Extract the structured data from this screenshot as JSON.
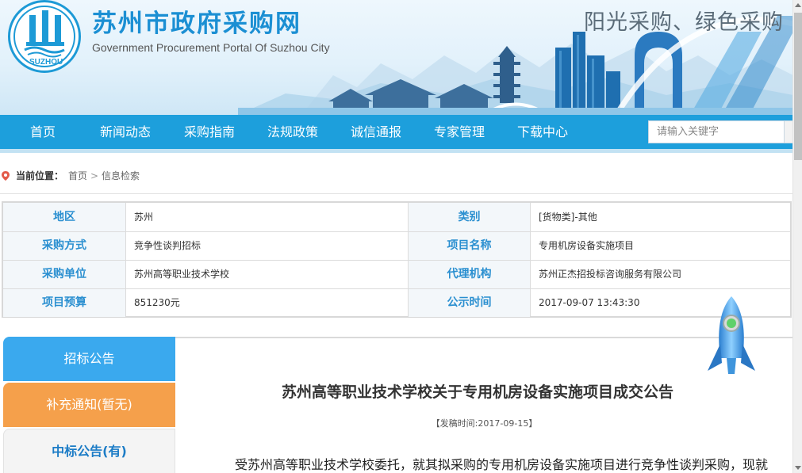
{
  "header": {
    "site_title": "苏州市政府采购网",
    "site_subtitle": "Government Procurement Portal Of Suzhou City",
    "logo_text": "SUZHOU",
    "slogan": "阳光采购、绿色采购"
  },
  "nav": {
    "items": [
      {
        "label": "首页"
      },
      {
        "label": "新闻动态"
      },
      {
        "label": "采购指南"
      },
      {
        "label": "法规政策"
      },
      {
        "label": "诚信通报"
      },
      {
        "label": "专家管理"
      },
      {
        "label": "下载中心"
      }
    ],
    "search_placeholder": "请输入关键字"
  },
  "breadcrumb": {
    "label": "当前位置：",
    "home": "首页",
    "separator": ">",
    "current": "信息检索"
  },
  "info_table": {
    "rows": [
      {
        "left_label": "地区",
        "left_value": "苏州",
        "right_label": "类别",
        "right_value": "[货物类]-其他"
      },
      {
        "left_label": "采购方式",
        "left_value": "竞争性谈判招标",
        "right_label": "项目名称",
        "right_value": "专用机房设备实施项目"
      },
      {
        "left_label": "采购单位",
        "left_value": "苏州高等职业技术学校",
        "right_label": "代理机构",
        "right_value": "苏州正杰招投标咨询服务有限公司"
      },
      {
        "left_label": "项目预算",
        "left_value": "851230元",
        "right_label": "公示时间",
        "right_value": "2017-09-07 13:43:30"
      }
    ]
  },
  "side_tabs": {
    "tab1": "招标公告",
    "tab2": "补充通知(暂无)",
    "tab3": "中标公告(有)"
  },
  "article": {
    "title": "苏州高等职业技术学校关于专用机房设备实施项目成交公告",
    "pubdate_label": "【发稿时间:",
    "pubdate_value": "2017-09-15",
    "pubdate_end": "】",
    "body_first_line": "受苏州高等职业技术学校委托，就其拟采购的专用机房设备实施项目进行竞争性谈判采购，现就"
  },
  "colors": {
    "nav_blue": "#1d9fdc",
    "label_blue": "#2a8fd0",
    "tab_blue": "#3aa9ee",
    "tab_orange": "#f5a04b"
  }
}
